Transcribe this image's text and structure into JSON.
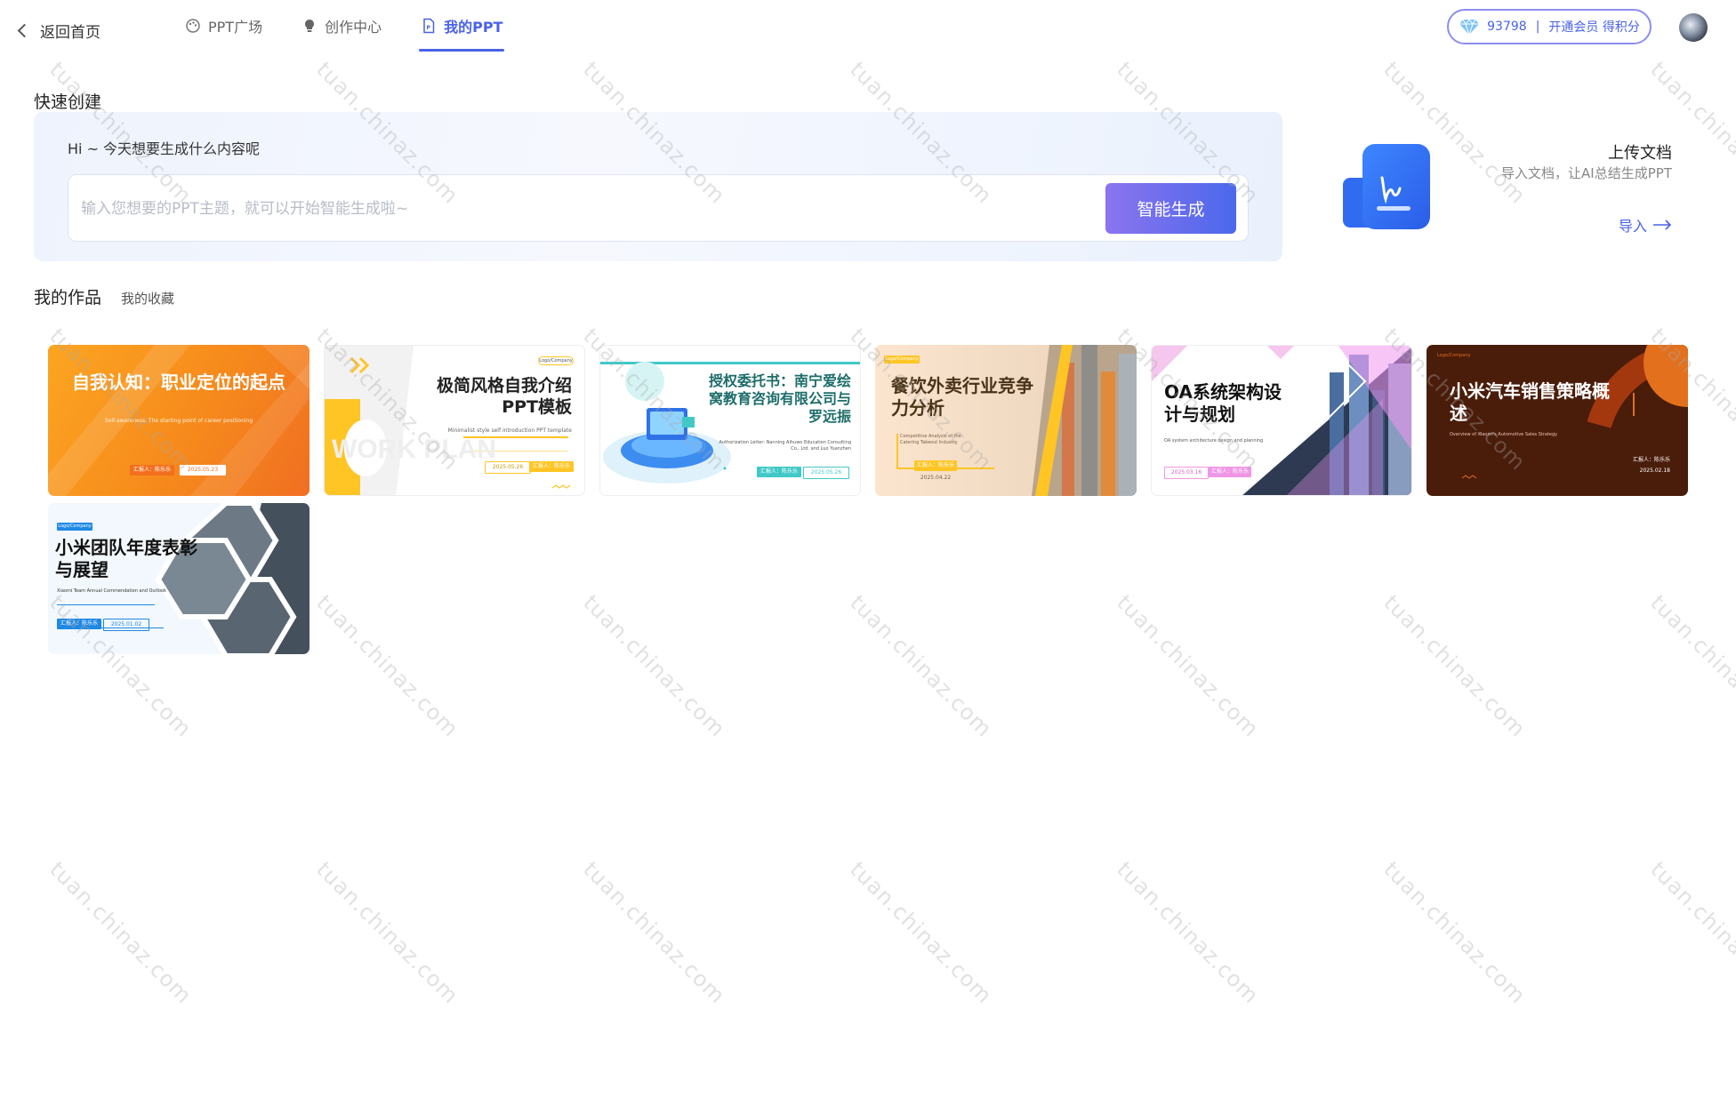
{
  "header": {
    "back_label": "返回首页",
    "tabs": [
      {
        "label": "PPT广场",
        "icon": "palette-icon"
      },
      {
        "label": "创作中心",
        "icon": "lightbulb-icon"
      },
      {
        "label": "我的PPT",
        "icon": "document-icon"
      }
    ],
    "active_tab": "我的PPT",
    "vip": {
      "points": "93798",
      "separator": "|",
      "cta": "开通会员 得积分",
      "icon": "diamond-icon"
    },
    "avatar_icon": "avatar"
  },
  "quick_create": {
    "title": "快速创建",
    "greeting": "Hi ~ 今天想要生成什么内容呢",
    "input_value": "",
    "input_placeholder": "输入您想要的PPT主题，就可以开始智能生成啦~",
    "generate_label": "智能生成"
  },
  "upload": {
    "title": "上传文档",
    "subtitle": "导入文档，让AI总结生成PPT",
    "link_label": "导入",
    "icon": "upload-document-icon"
  },
  "works": {
    "tabs": [
      "我的作品",
      "我的收藏"
    ],
    "active_tab": "我的作品",
    "cards": [
      {
        "title": "自我认知：职业定位的起点",
        "subtitle": "Self-awareness: The starting point of career positioning",
        "pill1": "汇报人：陈乐乐",
        "pill2": "2025.05.23",
        "theme": "orange"
      },
      {
        "title": "极简风格自我介绍PPT模板",
        "subtitle": "Minimalist style self introduction PPT template",
        "pill1": "2025.05.26",
        "pill2": "汇报人：陈乐乐",
        "logo": "Logo/Company",
        "bg_text": "WORK PLAN",
        "theme": "yellow"
      },
      {
        "title": "授权委托书：南宁爱绘窝教育咨询有限公司与罗远振",
        "subtitle": "Authorization Letter: Nanning Aihuwo Education Consulting Co., Ltd. and Luo Yuanzhen",
        "pill1": "汇报人：陈乐乐",
        "pill2": "2025.05.26",
        "theme": "teal"
      },
      {
        "title": "餐饮外卖行业竞争力分析",
        "subtitle": "Competitive Analysis of the Catering Takeout Industry",
        "pill1": "汇报人：陈乐乐",
        "pill2": "2025.04.22",
        "logo": "Logo/Company",
        "theme": "gold"
      },
      {
        "title": "OA系统架构设计与规划",
        "subtitle": "OA system architecture design and planning",
        "pill1": "2025.03.16",
        "pill2": "汇报人：陈乐乐",
        "theme": "pink"
      },
      {
        "title": "小米汽车销售策略概述",
        "subtitle": "Overview of Xiaomi's Automotive Sales Strategy",
        "pill1": "汇报人：陈乐乐",
        "pill2": "2025.02.18",
        "logo": "Logo/Company",
        "theme": "brown"
      },
      {
        "title": "小米团队年度表彰与展望",
        "subtitle": "Xiaomi Team Annual Commendation and Outlook",
        "pill1": "汇报人：陈乐乐",
        "pill2": "2025.01.02",
        "logo": "Logo/Company",
        "theme": "blue"
      }
    ]
  },
  "watermark": "tuan.chinaz.com",
  "colors": {
    "accent": "#4a62e8",
    "gradient_start": "#8c74ef",
    "gradient_end": "#4b68ec"
  }
}
